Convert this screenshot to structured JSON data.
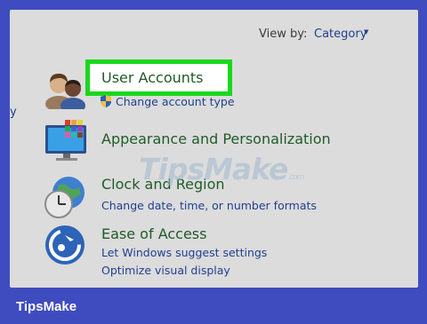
{
  "header": {
    "view_by_label": "View by:",
    "view_by_value": "Category"
  },
  "sidebar_edge_text": "y",
  "categories": [
    {
      "title": "User Accounts",
      "links": [
        "Change account type"
      ]
    },
    {
      "title": "Appearance and Personalization",
      "links": []
    },
    {
      "title": "Clock and Region",
      "links": [
        "Change date, time, or number formats"
      ]
    },
    {
      "title": "Ease of Access",
      "links": [
        "Let Windows suggest settings",
        "Optimize visual display"
      ]
    }
  ],
  "watermark": {
    "text": "TipsMake",
    "suffix": ".com"
  },
  "brand": "TipsMake",
  "colors": {
    "frame": "#3f4cc0",
    "panel": "#dcdcdc",
    "highlight": "#19d81c",
    "title_green": "#1f5b2a",
    "link_blue": "#1f3f8f"
  },
  "icons": [
    "users-icon",
    "shield-icon",
    "display-personalization-icon",
    "clock-globe-icon",
    "ease-of-access-icon"
  ]
}
